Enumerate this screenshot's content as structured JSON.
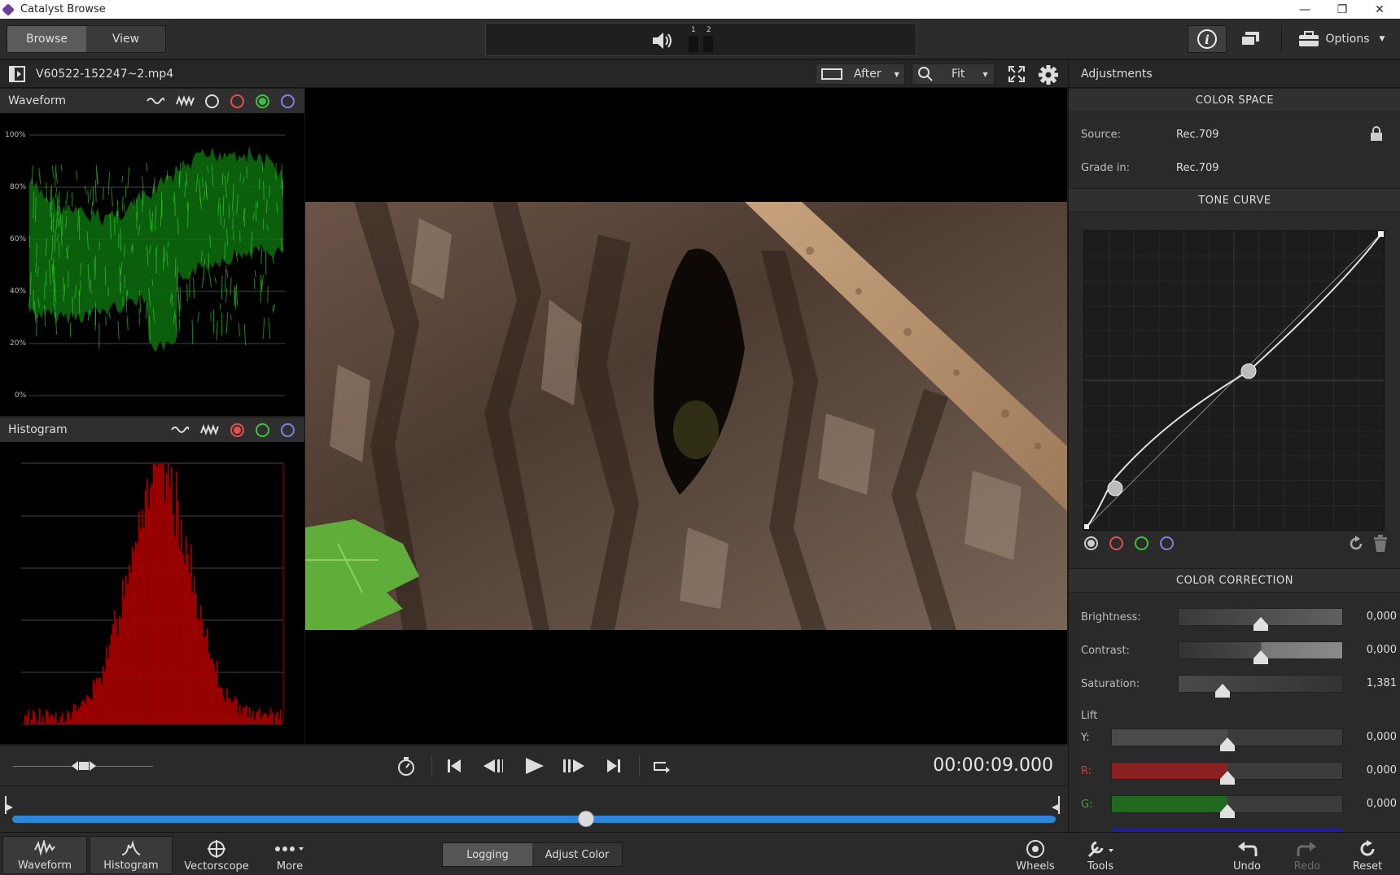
{
  "window": {
    "title": "Catalyst Browse",
    "minimize": "—",
    "restore": "❐",
    "close": "✕"
  },
  "toolbar": {
    "browse_label": "Browse",
    "view_label": "View",
    "meter_labels": [
      "1",
      "2"
    ],
    "options_label": "Options"
  },
  "filebar": {
    "filename": "V60522-152247~2.mp4",
    "view_mode": "After",
    "zoom": "Fit"
  },
  "waveform": {
    "title": "Waveform",
    "scale": [
      "100%",
      "80%",
      "60%",
      "40%",
      "20%",
      "0%"
    ]
  },
  "histogram": {
    "title": "Histogram"
  },
  "transport": {
    "timecode": "00:00:09.000",
    "playhead_fraction": 0.55
  },
  "bottombar": {
    "waveform": "Waveform",
    "histogram": "Histogram",
    "vectorscope": "Vectorscope",
    "more": "More",
    "logging": "Logging",
    "adjust_color": "Adjust Color",
    "wheels": "Wheels",
    "tools": "Tools",
    "undo": "Undo",
    "redo": "Redo",
    "reset": "Reset"
  },
  "adjustments": {
    "header": "Adjustments",
    "color_space": {
      "title": "COLOR SPACE",
      "source_label": "Source:",
      "source_value": "Rec.709",
      "grade_label": "Grade in:",
      "grade_value": "Rec.709"
    },
    "tone_curve": {
      "title": "TONE CURVE"
    },
    "color_correction": {
      "title": "COLOR CORRECTION",
      "brightness_label": "Brightness:",
      "brightness_value": "0,000",
      "brightness_level": 0.5,
      "contrast_label": "Contrast:",
      "contrast_value": "0,000",
      "contrast_level": 0.5,
      "saturation_label": "Saturation:",
      "saturation_value": "1,381",
      "saturation_level": 0.27,
      "lift_label": "Lift",
      "y_label": "Y:",
      "y_value": "0,000",
      "r_label": "R:",
      "r_value": "0,000",
      "g_label": "G:",
      "g_value": "0,000"
    }
  },
  "colors": {
    "accent_blue": "#2e86d8",
    "waveform_green": "#22c822",
    "histogram_red": "#a00000",
    "red_channel": "#e05050",
    "green_channel": "#40c040",
    "blue_channel": "#8080e0"
  }
}
